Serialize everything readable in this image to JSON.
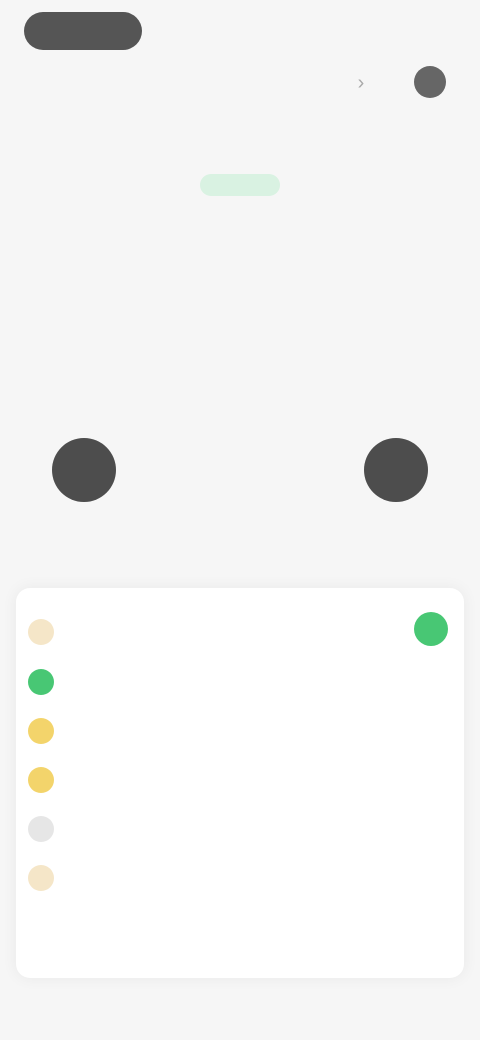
{
  "status_bar": {
    "left_pill_label": "",
    "right_text": ""
  },
  "hero": {
    "badge": "",
    "text": ""
  },
  "center": {
    "title": "",
    "value": "",
    "subtitle": ""
  },
  "card": {
    "items": [
      {
        "label": "",
        "color": "#f5e6c8"
      },
      {
        "label": "",
        "color": "#48c774"
      },
      {
        "label": "",
        "color": "#f3d46b"
      },
      {
        "label": "",
        "color": "#f3d46b"
      },
      {
        "label": "",
        "color": "#e6e6e6"
      },
      {
        "label": "",
        "color": "#f5e6c8"
      }
    ],
    "toggle_color": "#48c774"
  },
  "tabs": [
    {
      "label": ""
    },
    {
      "label": ""
    },
    {
      "label": ""
    },
    {
      "label": ""
    },
    {
      "label": ""
    }
  ],
  "icons": {
    "top_action_a": "chevron-icon",
    "top_action_b": "avatar-icon"
  }
}
